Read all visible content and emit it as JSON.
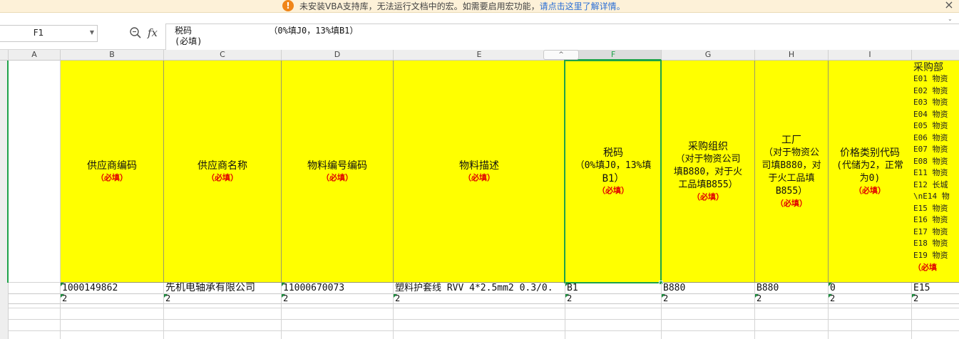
{
  "banner": {
    "message": "未安装VBA支持库，无法运行文档中的宏。如需要启用宏功能，",
    "link": "请点击这里了解详情。",
    "warning_icon": "!",
    "close_icon": "×"
  },
  "formula_bar": {
    "name_box": "F1",
    "fx_label": "fx",
    "content_line1": "税码               （0%填J0，13%填B1）",
    "content_line2": "(必填)"
  },
  "columns": [
    "A",
    "B",
    "C",
    "D",
    "E",
    "F",
    "G",
    "H",
    "I"
  ],
  "column_collapse_icon": "^",
  "header_row": {
    "B": {
      "text": "供应商编码",
      "req": "（必填）"
    },
    "C": {
      "text": "供应商名称",
      "req": "（必填）"
    },
    "D": {
      "text": "物料编号编码",
      "req": "（必填）"
    },
    "E": {
      "text": "物料描述",
      "req": "（必填）"
    },
    "F": {
      "l1": "税码",
      "l2": "（0%填J0，13%填",
      "l3": "B1）",
      "req": "（必填）"
    },
    "G": {
      "l1": "采购组织",
      "l2": "（对于物资公司",
      "l3": "填B880，对于火",
      "l4": "工品填B855）",
      "req": "（必填）"
    },
    "H": {
      "l1": "工厂",
      "l2": "（对于物资公",
      "l3": "司填B880，对",
      "l4": "于火工品填",
      "l5": "B855）",
      "req": "（必填）"
    },
    "I": {
      "l1": "价格类别代码",
      "l2": "(代储为2，正常",
      "l3": "为0)",
      "req": "（必填）"
    },
    "J": {
      "title": "采购部",
      "lines": [
        "E01 物资",
        "E02 物资",
        "E03 物资",
        "E04 物资",
        "E05 物资",
        "E06 物资",
        "E07 物资",
        "E08 物资",
        "E11 物资",
        "E12 长城",
        "\\nE14 物",
        "E15 物资",
        "E16 物资",
        "E17 物资",
        "E18 物资",
        "E19 物资"
      ],
      "req": "（必填"
    }
  },
  "data_rows": [
    {
      "B": "1000149862",
      "C": "先机电轴承有限公司",
      "D": "11000670073",
      "E": "塑料护套线 RVV 4*2.5mm2 0.3/0.",
      "F": "B1",
      "G": "B880",
      "H": "B880",
      "I": "0",
      "J": "E15"
    },
    {
      "B": "2",
      "C": "2",
      "D": "2",
      "E": "2",
      "F": "2",
      "G": "2",
      "H": "2",
      "I": "2",
      "J": "2"
    }
  ]
}
